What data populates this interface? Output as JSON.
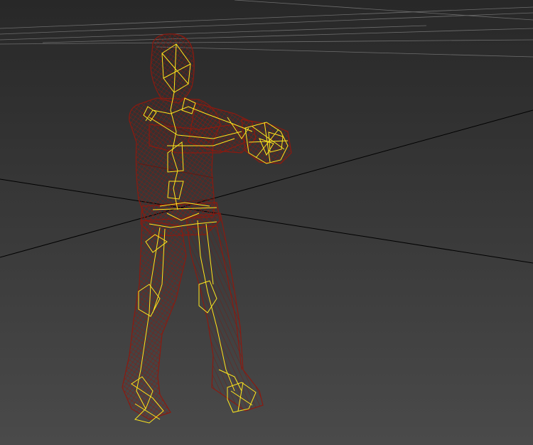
{
  "viewport": {
    "name": "3D viewport",
    "view": "perspective",
    "display_mode": "wireframe",
    "background_top": "#282828",
    "background_bottom": "#4a4a4a"
  },
  "scene": {
    "ground_grid": "visible",
    "home_grid_axes": "visible",
    "character_mesh": {
      "name": "character-mesh",
      "wire_color": "#8b1a10"
    },
    "skeleton_bones": {
      "name": "biped-skeleton",
      "wire_color": "#ffe81e"
    }
  },
  "colors": {
    "grid_line": "#6e6e6e",
    "axis_line": "#000000",
    "mesh": "#8b1a10",
    "bones": "#ffe81e"
  }
}
